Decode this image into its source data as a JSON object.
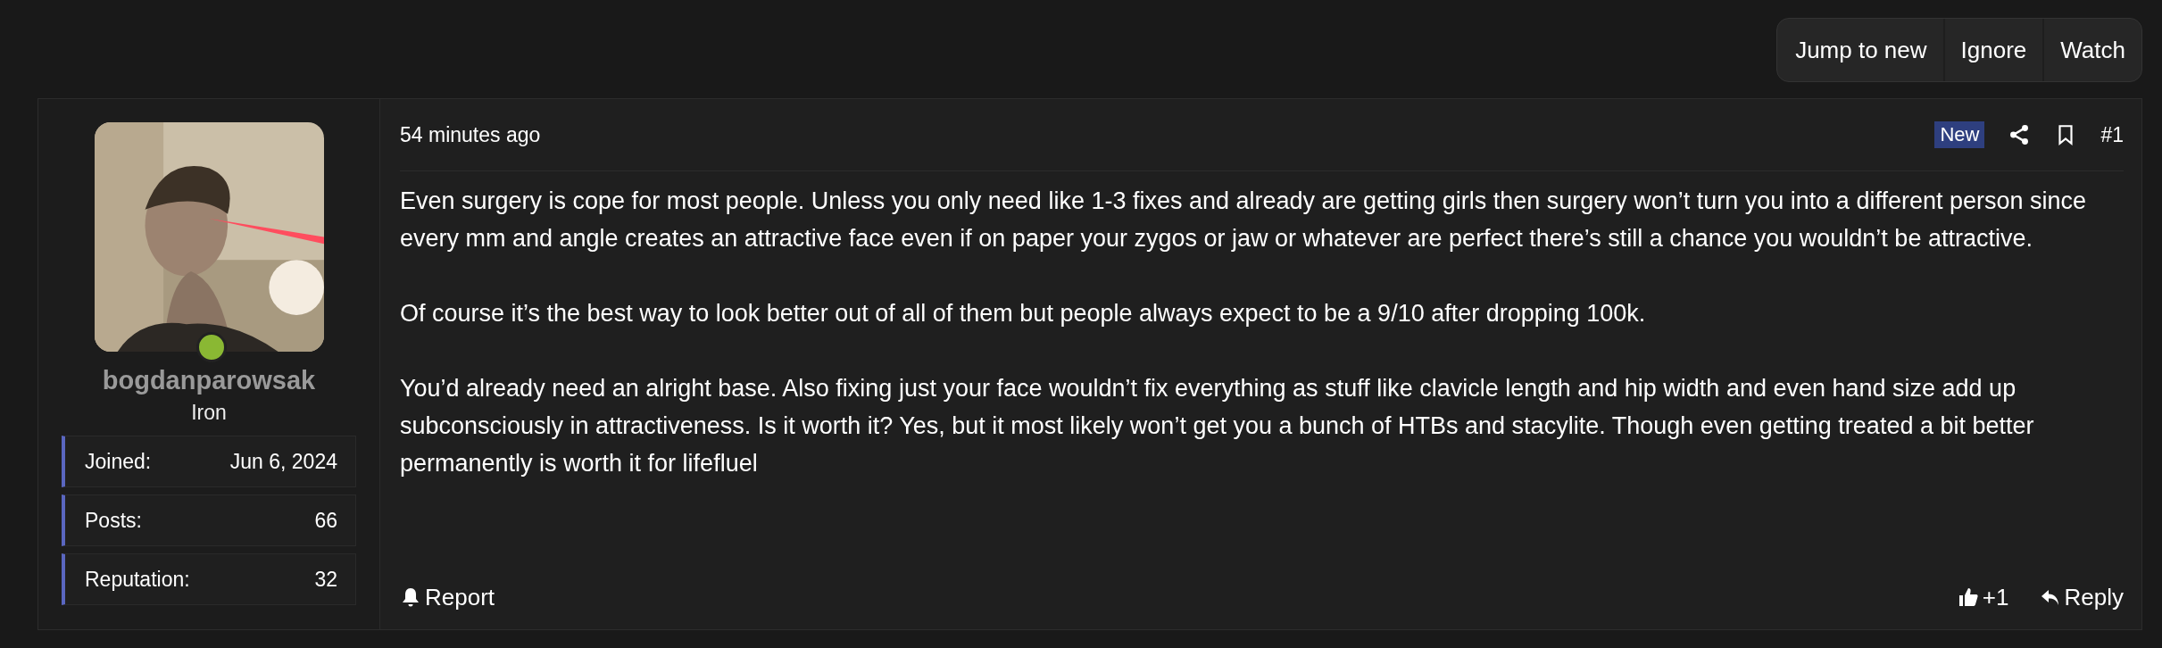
{
  "thread_actions": [
    {
      "label": "Jump to new"
    },
    {
      "label": "Ignore"
    },
    {
      "label": "Watch"
    }
  ],
  "user": {
    "online": true,
    "username": "bogdanparowsak",
    "rank": "Iron",
    "stats": [
      {
        "label": "Joined:",
        "value": "Jun 6, 2024"
      },
      {
        "label": "Posts:",
        "value": "66"
      },
      {
        "label": "Reputation:",
        "value": "32"
      }
    ]
  },
  "post": {
    "time": "54 minutes ago",
    "badge": "New",
    "number": "#1",
    "paragraphs": [
      "Even surgery is cope for most people. Unless you only need like 1-3 fixes and already are getting girls then surgery won’t turn you into a different person since every mm and angle creates an attractive face even if on paper your zygos or jaw or whatever are perfect there’s still a chance you wouldn’t be attractive.",
      "Of course it’s the best way to look better out of all of them but people always expect to be a 9/10 after dropping 100k.",
      "You’d already need an alright base. Also fixing just your face wouldn’t fix everything as stuff like clavicle length and hip width and even hand size add up subconsciously in attractiveness. Is it worth it? Yes, but it most likely won’t get you a bunch of HTBs and stacylite. Though even getting treated a bit better permanently is worth it for lifefluel"
    ],
    "report": "Report",
    "likes": "+1",
    "reply": "Reply"
  }
}
